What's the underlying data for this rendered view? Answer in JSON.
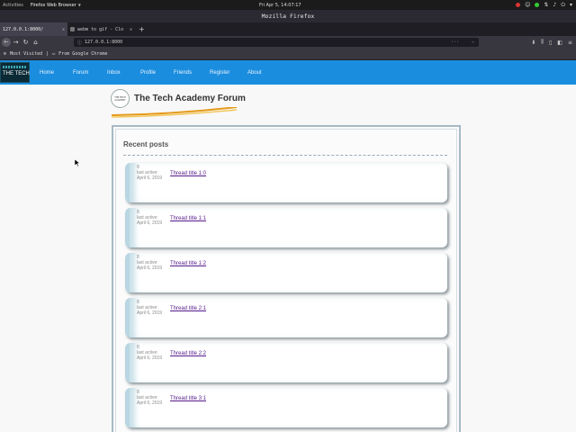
{
  "system": {
    "activities": "Activities",
    "app_menu": "Firefox Web Browser",
    "clock": "Fri Apr 5, 14:07:17"
  },
  "window": {
    "title": "Mozilla Firefox"
  },
  "tabs": [
    {
      "label": "127.0.0.1:8000/"
    },
    {
      "label": "webm to gif - Clo"
    }
  ],
  "toolbar": {
    "url": "127.0.0.1:8000",
    "url_actions": "···"
  },
  "bookmarks": {
    "most_visited": "Most Visited",
    "separator": "|",
    "from_chrome": "From Google Chrome"
  },
  "site": {
    "logo_text": "THE TECH",
    "nav": [
      "Home",
      "Forum",
      "Inbox",
      "Profile",
      "Friends",
      "Register",
      "About"
    ],
    "brand_title": "The Tech Academy Forum",
    "badge_text": "THE TECH ACADEMY",
    "section_title": "Recent posts",
    "posts": [
      {
        "author": "8",
        "active_label": "last active:",
        "date": "April 6, 2019",
        "title": "Thread title 1:0"
      },
      {
        "author": "8",
        "active_label": "last active:",
        "date": "April 6, 2019",
        "title": "Thread title 1:1"
      },
      {
        "author": "8",
        "active_label": "last active:",
        "date": "April 6, 2019",
        "title": "Thread title 1:2"
      },
      {
        "author": "8",
        "active_label": "last active:",
        "date": "April 6, 2019",
        "title": "Thread title 2:1"
      },
      {
        "author": "8",
        "active_label": "last active:",
        "date": "April 6, 2019",
        "title": "Thread title 2:2"
      },
      {
        "author": "8",
        "active_label": "last active:",
        "date": "April 6, 2019",
        "title": "Thread title 3:1"
      }
    ]
  },
  "colors": {
    "nav_blue": "#1b8ddf",
    "link_visited": "#551a8b",
    "panel_border": "#a7b9c4"
  }
}
